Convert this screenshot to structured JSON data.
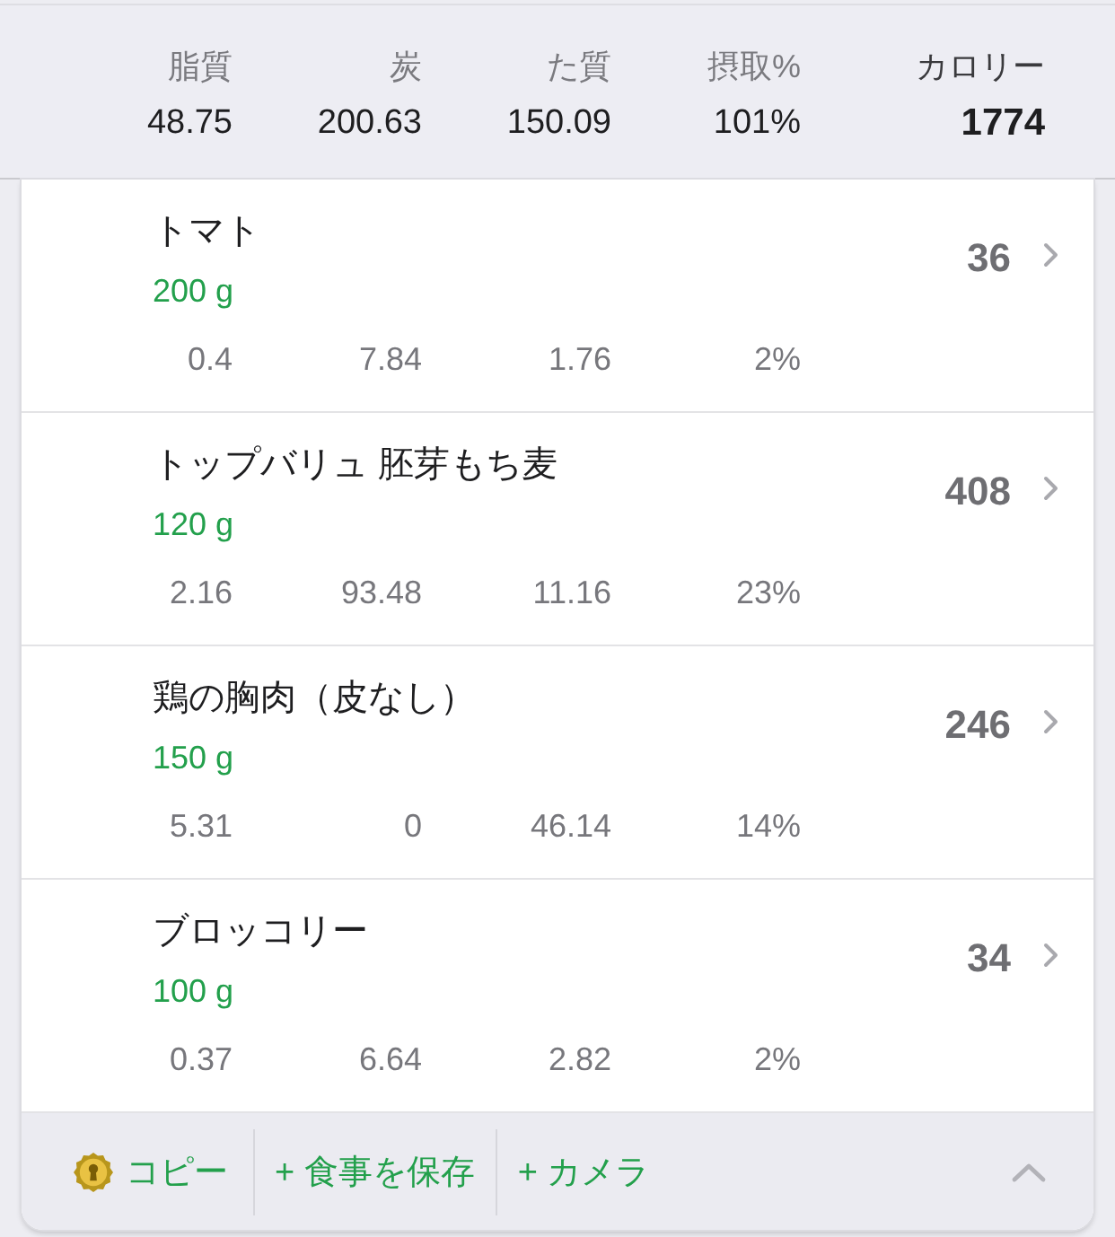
{
  "summary": {
    "columns": [
      {
        "label": "脂質",
        "value": "48.75"
      },
      {
        "label": "炭",
        "value": "200.63"
      },
      {
        "label": "た質",
        "value": "150.09"
      },
      {
        "label": "摂取%",
        "value": "101%"
      }
    ],
    "calories": {
      "label": "カロリー",
      "value": "1774"
    }
  },
  "foods": [
    {
      "name": "トマト",
      "amount": "200 g",
      "calories": "36",
      "stats": [
        "0.4",
        "7.84",
        "1.76",
        "2%"
      ]
    },
    {
      "name": "トップバリュ 胚芽もち麦",
      "amount": "120 g",
      "calories": "408",
      "stats": [
        "2.16",
        "93.48",
        "11.16",
        "23%"
      ]
    },
    {
      "name": "鶏の胸肉（皮なし）",
      "amount": "150 g",
      "calories": "246",
      "stats": [
        "5.31",
        "0",
        "46.14",
        "14%"
      ]
    },
    {
      "name": "ブロッコリー",
      "amount": "100 g",
      "calories": "34",
      "stats": [
        "0.37",
        "6.64",
        "2.82",
        "2%"
      ]
    }
  ],
  "footer": {
    "actions": [
      {
        "kind": "copy",
        "label": "コピー"
      },
      {
        "kind": "add",
        "label": "+ 食事を保存"
      },
      {
        "kind": "add",
        "label": "+ カメラ"
      }
    ]
  }
}
